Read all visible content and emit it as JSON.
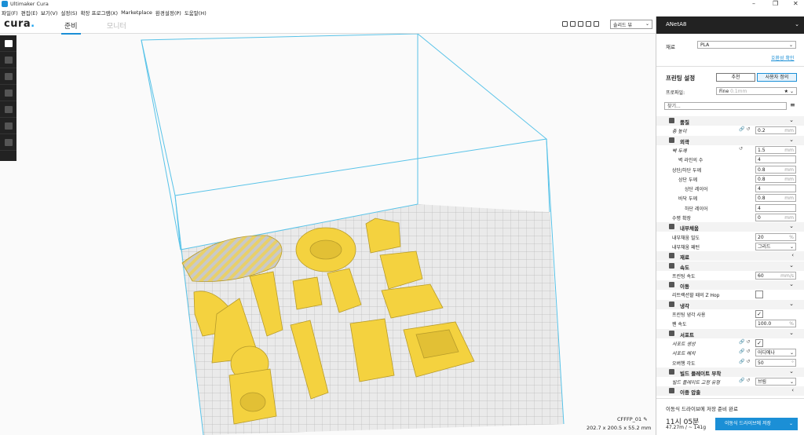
{
  "window": {
    "title": "Ultimaker Cura",
    "controls": [
      "–",
      "❐",
      "✕"
    ]
  },
  "menu": [
    "파일(F)",
    "편집(E)",
    "보기(V)",
    "설정(S)",
    "확장 프로그램(X)",
    "Marketplace",
    "환경설정(P)",
    "도움말(H)"
  ],
  "header": {
    "logo": "cura",
    "logo_dot": ".",
    "tab_prepare": "준비",
    "tab_monitor": "모니터",
    "view_select": "솔리드 뷰",
    "view_chev": "⌄"
  },
  "printer": {
    "name": "ANetA8",
    "chev": "⌄"
  },
  "material": {
    "label": "재료",
    "value": "PLA",
    "chev": "⌄",
    "compat_link": "호환성 확인"
  },
  "print_settings": {
    "title": "프린팅 설정",
    "btn_recommended": "추천",
    "btn_custom": "사용자 정의",
    "profile_label": "프로파일:",
    "profile_value": "Fine",
    "profile_hint": "0.1mm",
    "profile_star": "★",
    "chev": "⌄",
    "search_placeholder": "찾기..."
  },
  "settings": [
    {
      "type": "cat",
      "label": "품질",
      "arrow": "⌄"
    },
    {
      "type": "row",
      "label": "층 높이",
      "value": "0.2",
      "unit": "mm",
      "icons": "🔗 ↺",
      "italic": true,
      "indent": 0
    },
    {
      "type": "cat",
      "label": "외곽",
      "arrow": "⌄"
    },
    {
      "type": "row",
      "label": "벽 두께",
      "value": "1.5",
      "unit": "mm",
      "icons": "↺",
      "italic": true,
      "indent": 0
    },
    {
      "type": "row",
      "label": "벽 라인의 수",
      "value": "4",
      "unit": "",
      "indent": 8
    },
    {
      "type": "row",
      "label": "상단/하단 두께",
      "value": "0.8",
      "unit": "mm",
      "indent": 0
    },
    {
      "type": "row",
      "label": "상단 두께",
      "value": "0.8",
      "unit": "mm",
      "indent": 8
    },
    {
      "type": "row",
      "label": "상단 레이어",
      "value": "4",
      "unit": "",
      "indent": 16
    },
    {
      "type": "row",
      "label": "바닥 두께",
      "value": "0.8",
      "unit": "mm",
      "indent": 8
    },
    {
      "type": "row",
      "label": "하단 레이어",
      "value": "4",
      "unit": "",
      "indent": 16
    },
    {
      "type": "row",
      "label": "수평 확장",
      "value": "0",
      "unit": "mm",
      "indent": 0
    },
    {
      "type": "cat",
      "label": "내부채움",
      "arrow": "⌄"
    },
    {
      "type": "row",
      "label": "내부채움 밀도",
      "value": "20",
      "unit": "%",
      "indent": 0
    },
    {
      "type": "row",
      "label": "내부채움 패턴",
      "value": "그리드",
      "unit": "",
      "dropdown": true,
      "indent": 0
    },
    {
      "type": "cat",
      "label": "재료",
      "arrow": "‹"
    },
    {
      "type": "cat",
      "label": "속도",
      "arrow": "⌄"
    },
    {
      "type": "row",
      "label": "프린팅 속도",
      "value": "60",
      "unit": "mm/s",
      "indent": 0
    },
    {
      "type": "cat",
      "label": "이동",
      "arrow": "⌄"
    },
    {
      "type": "row",
      "label": "리트랙션할 때의 Z Hop",
      "value": "",
      "check": true,
      "checked": false,
      "indent": 0
    },
    {
      "type": "cat",
      "label": "냉각",
      "arrow": "⌄"
    },
    {
      "type": "row",
      "label": "프린팅 냉각 사용",
      "value": "",
      "check": true,
      "checked": true,
      "indent": 0
    },
    {
      "type": "row",
      "label": "팬 속도",
      "value": "100.0",
      "unit": "%",
      "indent": 0
    },
    {
      "type": "cat",
      "label": "서포트",
      "arrow": "⌄"
    },
    {
      "type": "row",
      "label": "서포트 생성",
      "value": "",
      "check": true,
      "checked": true,
      "icons": "🔗 ↺",
      "italic": true,
      "indent": 0
    },
    {
      "type": "row",
      "label": "서포트 배치",
      "value": "어디에나",
      "unit": "",
      "dropdown": true,
      "icons": "🔗 ↺",
      "italic": true,
      "indent": 0
    },
    {
      "type": "row",
      "label": "오버행 각도",
      "value": "50",
      "unit": "°",
      "icons": "🔗 ↺",
      "indent": 0
    },
    {
      "type": "cat",
      "label": "빌드 플레이트 부착",
      "arrow": "⌄"
    },
    {
      "type": "row",
      "label": "빌드 플레이트 고정 유형",
      "value": "브림",
      "unit": "",
      "dropdown": true,
      "icons": "🔗 ↺",
      "italic": true,
      "indent": 0
    },
    {
      "type": "cat",
      "label": "이중 압출",
      "arrow": "‹"
    }
  ],
  "footer": {
    "status": "이동식 드라이브에 저장 준비 완료",
    "time": "11시 05분",
    "material_usage": "47.27m / ~ 141g",
    "save_button": "이동식 드라이브에 저장",
    "save_chev": "⌄"
  },
  "job": {
    "name": "CFFFP_01",
    "dims": "202.7 x 200.5 x 55.2 mm",
    "edit_icon": "✎"
  }
}
